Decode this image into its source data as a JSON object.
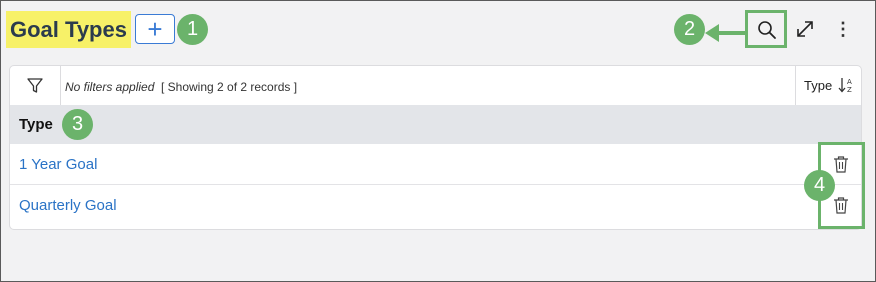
{
  "header": {
    "title": "Goal Types",
    "add_label": "+",
    "more_label": "⋮"
  },
  "callouts": [
    "1",
    "2",
    "3",
    "4"
  ],
  "toolbar": {
    "filters_text": "No filters applied",
    "records_text": "[ Showing 2 of 2 records ]",
    "sort_label": "Type"
  },
  "table": {
    "column_header": "Type",
    "rows": [
      {
        "type": "1 Year Goal"
      },
      {
        "type": "Quarterly Goal"
      }
    ]
  },
  "icons": [
    "plus-icon",
    "search-icon",
    "expand-icon",
    "more-vertical-icon",
    "filter-icon",
    "sort-icon",
    "trash-icon"
  ],
  "colors": {
    "title_highlight": "#f7f168",
    "callout_green": "#6bb36b",
    "link_blue": "#2a73c6",
    "accent_blue": "#3a7bd5",
    "header_gray": "#e3e5e9"
  }
}
